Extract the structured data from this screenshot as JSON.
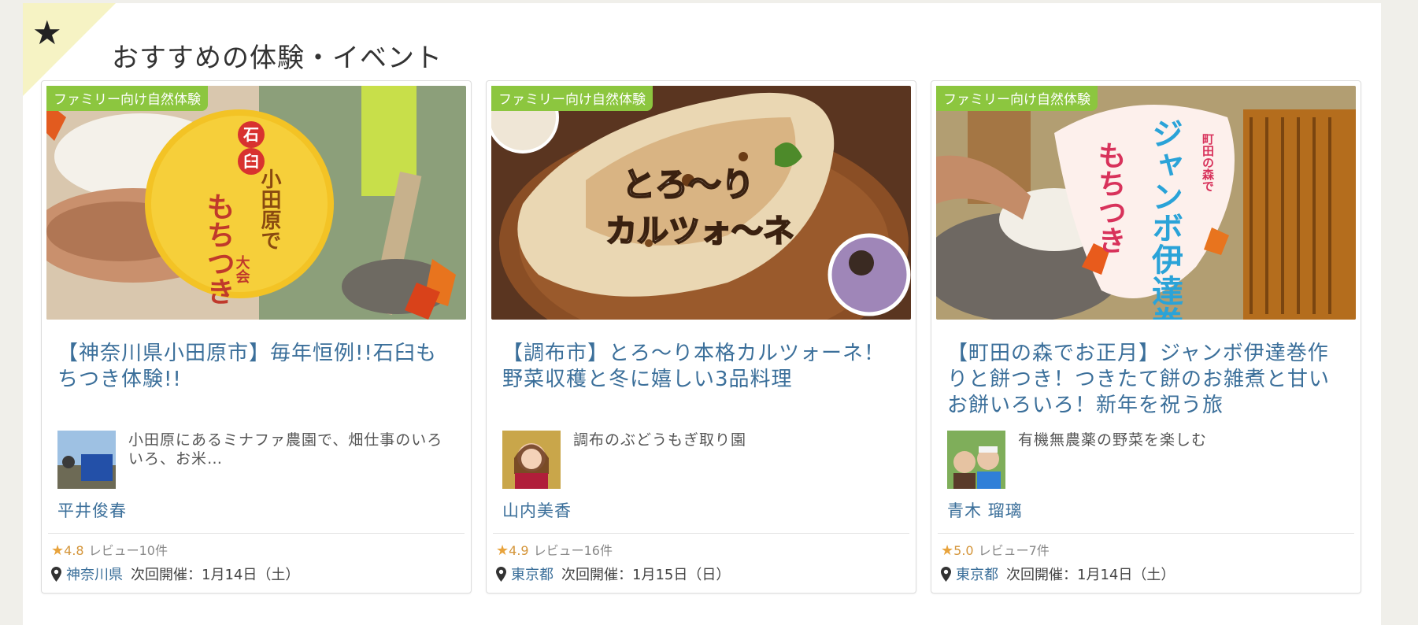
{
  "section": {
    "title": "おすすめの体験・イベント"
  },
  "cards": [
    {
      "tag": "ファミリー向け自然体験",
      "title": "【神奈川県小田原市】毎年恒例!!石臼もちつき体験!!",
      "host_desc": "小田原にあるミナファ農園で、畑仕事のいろいろ、お米…",
      "host_name": "平井俊春",
      "rating": "4.8",
      "reviews": "レビュー10件",
      "prefecture": "神奈川県",
      "next_event": "次回開催：1月14日（土）",
      "image_text": {
        "a": "石",
        "b": "臼",
        "c": "もちつき",
        "d": "小田原で",
        "e": "大会"
      }
    },
    {
      "tag": "ファミリー向け自然体験",
      "title": "【調布市】とろ〜り本格カルツォーネ！野菜収穫と冬に嬉しい3品料理",
      "host_desc": "調布のぶどうもぎ取り園",
      "host_name": "山内美香",
      "rating": "4.9",
      "reviews": "レビュー16件",
      "prefecture": "東京都",
      "next_event": "次回開催：1月15日（日）",
      "image_text": {
        "a": "とろ〜り",
        "b": "カルツォ〜ネ"
      }
    },
    {
      "tag": "ファミリー向け自然体験",
      "title": "【町田の森でお正月】ジャンボ伊達巻作りと餅つき！つきたて餅のお雑煮と甘いお餅いろいろ！新年を祝う旅",
      "host_desc": "有機無農薬の野菜を楽しむ",
      "host_name": "青木 瑠璃",
      "rating": "5.0",
      "reviews": "レビュー7件",
      "prefecture": "東京都",
      "next_event": "次回開催：1月14日（土）",
      "image_text": {
        "a": "ジャンボ伊達巻",
        "b": "もちつき",
        "c": "町田の森で"
      }
    }
  ],
  "colors": {
    "accent_green": "#8cc63f",
    "title_blue": "#3b6f9a",
    "star_orange": "#e8a33c"
  },
  "icons": {
    "section": "star-icon",
    "rating": "rating-star-icon",
    "location": "map-pin-icon"
  }
}
